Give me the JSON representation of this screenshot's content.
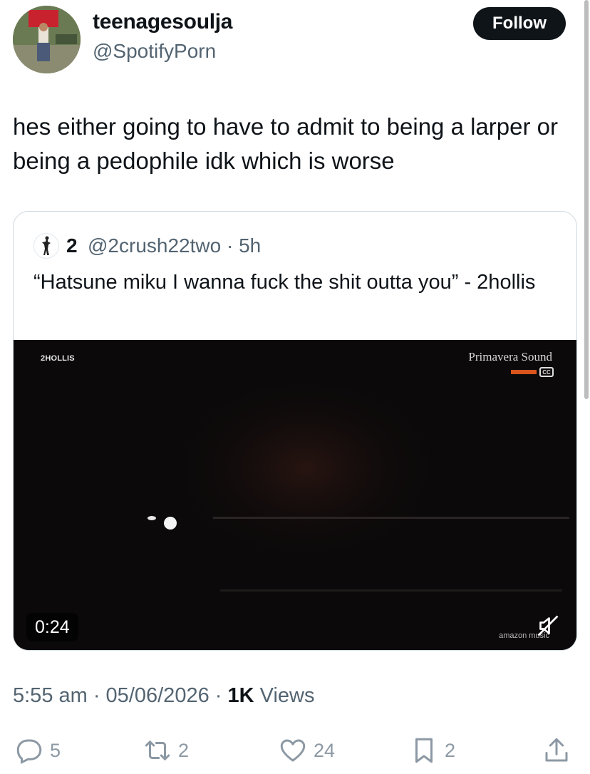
{
  "author": {
    "display_name": "teenagesoulja",
    "handle": "@SpotifyPorn",
    "follow_label": "Follow"
  },
  "tweet": {
    "text": "hes either going to have to admit to being a larper or being a pedophile idk which is worse"
  },
  "quoted": {
    "display_name": "2",
    "handle_time": "@2crush22two · 5h",
    "text": "“Hatsune miku I wanna fuck the shit outta you” - 2hollis",
    "video": {
      "watermark": "2HOLLIS",
      "brand": "Primavera Sound",
      "duration": "0:24",
      "corner_brand": "amazon music"
    }
  },
  "meta": {
    "time_date": "5:55 am · 05/06/2026 · ",
    "views_count": "1K",
    "views_label": " Views"
  },
  "actions": {
    "replies": "5",
    "reposts": "2",
    "likes": "24",
    "bookmarks": "2"
  }
}
